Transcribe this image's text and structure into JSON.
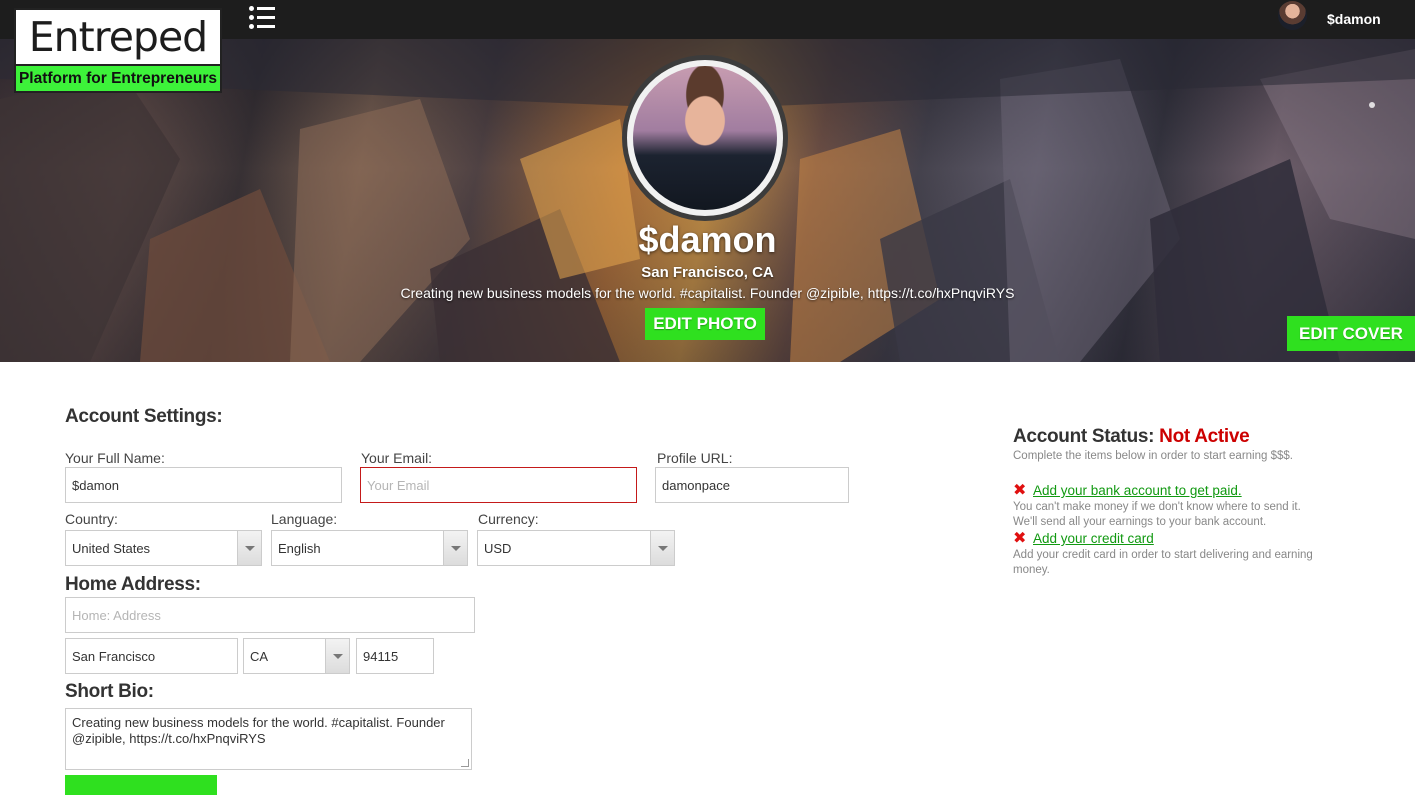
{
  "brand": {
    "name": "Entreped",
    "tagline": "Platform for Entrepreneurs"
  },
  "header": {
    "username": "$damon"
  },
  "profile": {
    "name": "$damon",
    "location": "San Francisco, CA",
    "bio": "Creating new business models for the world. #capitalist. Founder @zipible, https://t.co/hxPnqviRYS",
    "edit_photo_label": "EDIT PHOTO",
    "edit_cover_label": "EDIT COVER"
  },
  "account": {
    "title": "Account Settings:",
    "full_name_label": "Your Full Name:",
    "full_name_value": "$damon",
    "email_label": "Your Email:",
    "email_placeholder": "Your Email",
    "profile_url_label": "Profile URL:",
    "profile_url_value": "damonpace",
    "country_label": "Country:",
    "country_value": "United States",
    "language_label": "Language:",
    "language_value": "English",
    "currency_label": "Currency:",
    "currency_value": "USD"
  },
  "address": {
    "title": "Home Address:",
    "street_placeholder": "Home: Address",
    "city_value": "San Francisco",
    "state_value": "CA",
    "zip_value": "94115"
  },
  "short_bio": {
    "title": "Short Bio:",
    "line1": "Creating new business models for the world. #capitalist. Founder",
    "line2": "@zipible, https://t.co/hxPnqviRYS"
  },
  "status": {
    "label": "Account Status:",
    "value": "Not Active",
    "value_color": "#cc0000",
    "intro": "Complete the items below in order to start earning $$$.",
    "items": [
      {
        "link": "Add your bank account to get paid.",
        "desc1": "You can't make money if we don't know where to send it.",
        "desc2": "We'll send all your earnings to your bank account."
      },
      {
        "link": "Add your credit card",
        "desc1": "Add your credit card in order to start delivering and earning",
        "desc2": "money."
      }
    ]
  },
  "colors": {
    "accent_green": "#2fe01f",
    "topbar": "#1d1d1d",
    "error": "#c41a1a",
    "link": "#119911"
  },
  "icons": [
    "menu-list-icon",
    "close-x-icon",
    "select-arrow-icon"
  ]
}
